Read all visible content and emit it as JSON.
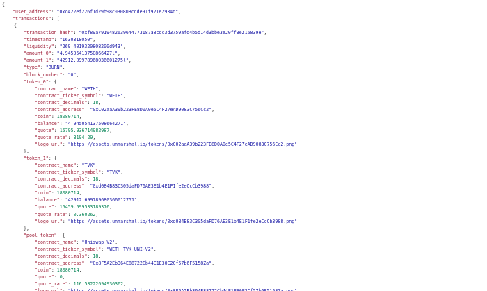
{
  "json_doc": {
    "lines": [
      {
        "indent": 0,
        "parts": [
          {
            "t": "p",
            "v": "{"
          }
        ]
      },
      {
        "indent": 1,
        "parts": [
          {
            "t": "k",
            "v": "\"user_address\""
          },
          {
            "t": "p",
            "v": ": "
          },
          {
            "t": "s",
            "v": "\"0xc422ef226f1d29b98c030808cdde91f921e2934d\""
          },
          {
            "t": "p",
            "v": ","
          }
        ]
      },
      {
        "indent": 1,
        "parts": [
          {
            "t": "k",
            "v": "\"transactions\""
          },
          {
            "t": "p",
            "v": ": ["
          }
        ]
      },
      {
        "indent": 2,
        "parts": [
          {
            "t": "p",
            "v": "{"
          }
        ]
      },
      {
        "indent": 3,
        "parts": [
          {
            "t": "k",
            "v": "\"transaction_hash\""
          },
          {
            "t": "p",
            "v": ": "
          },
          {
            "t": "s",
            "v": "\"0xf89a7919482639644773187a8cdc3d3759afd4b5d14d3bbe3e20ff3e216839e\""
          },
          {
            "t": "p",
            "v": ","
          }
        ]
      },
      {
        "indent": 3,
        "parts": [
          {
            "t": "k",
            "v": "\"timestamp\""
          },
          {
            "t": "p",
            "v": ": "
          },
          {
            "t": "s",
            "v": "\"1630318050\""
          },
          {
            "t": "p",
            "v": ","
          }
        ]
      },
      {
        "indent": 3,
        "parts": [
          {
            "t": "k",
            "v": "\"liquidity\""
          },
          {
            "t": "p",
            "v": ": "
          },
          {
            "t": "s",
            "v": "\"269.4019320808200d943\""
          },
          {
            "t": "p",
            "v": ","
          }
        ]
      },
      {
        "indent": 3,
        "parts": [
          {
            "t": "k",
            "v": "\"amount_0\""
          },
          {
            "t": "p",
            "v": ": "
          },
          {
            "t": "s",
            "v": "\"4.94505413750866427l\""
          },
          {
            "t": "p",
            "v": ","
          }
        ]
      },
      {
        "indent": 3,
        "parts": [
          {
            "t": "k",
            "v": "\"amount_1\""
          },
          {
            "t": "p",
            "v": ": "
          },
          {
            "t": "s",
            "v": "\"42912.09978968036601275l\""
          },
          {
            "t": "p",
            "v": ","
          }
        ]
      },
      {
        "indent": 3,
        "parts": [
          {
            "t": "k",
            "v": "\"type\""
          },
          {
            "t": "p",
            "v": ": "
          },
          {
            "t": "s",
            "v": "\"BURN\""
          },
          {
            "t": "p",
            "v": ","
          }
        ]
      },
      {
        "indent": 3,
        "parts": [
          {
            "t": "k",
            "v": "\"block_number\""
          },
          {
            "t": "p",
            "v": ": "
          },
          {
            "t": "s",
            "v": "\"0\""
          },
          {
            "t": "p",
            "v": ","
          }
        ]
      },
      {
        "indent": 3,
        "parts": [
          {
            "t": "k",
            "v": "\"token_0\""
          },
          {
            "t": "p",
            "v": ": {"
          }
        ]
      },
      {
        "indent": 4,
        "parts": [
          {
            "t": "k",
            "v": "\"contract_name\""
          },
          {
            "t": "p",
            "v": ": "
          },
          {
            "t": "s",
            "v": "\"WETH\""
          },
          {
            "t": "p",
            "v": ","
          }
        ]
      },
      {
        "indent": 4,
        "parts": [
          {
            "t": "k",
            "v": "\"contract_ticker_symbol\""
          },
          {
            "t": "p",
            "v": ": "
          },
          {
            "t": "s",
            "v": "\"WETH\""
          },
          {
            "t": "p",
            "v": ","
          }
        ]
      },
      {
        "indent": 4,
        "parts": [
          {
            "t": "k",
            "v": "\"contract_decimals\""
          },
          {
            "t": "p",
            "v": ": "
          },
          {
            "t": "n",
            "v": "18"
          },
          {
            "t": "p",
            "v": ","
          }
        ]
      },
      {
        "indent": 4,
        "parts": [
          {
            "t": "k",
            "v": "\"contract_address\""
          },
          {
            "t": "p",
            "v": ": "
          },
          {
            "t": "s",
            "v": "\"0xC02aaA39b223FE8D0A0e5C4F27eAD9083C756Cc2\""
          },
          {
            "t": "p",
            "v": ","
          }
        ]
      },
      {
        "indent": 4,
        "parts": [
          {
            "t": "k",
            "v": "\"coin\""
          },
          {
            "t": "p",
            "v": ": "
          },
          {
            "t": "n",
            "v": "18080714"
          },
          {
            "t": "p",
            "v": ","
          }
        ]
      },
      {
        "indent": 4,
        "parts": [
          {
            "t": "k",
            "v": "\"balance\""
          },
          {
            "t": "p",
            "v": ": "
          },
          {
            "t": "s",
            "v": "\"4.945054137508664271\""
          },
          {
            "t": "p",
            "v": ","
          }
        ]
      },
      {
        "indent": 4,
        "parts": [
          {
            "t": "k",
            "v": "\"quote\""
          },
          {
            "t": "p",
            "v": ": "
          },
          {
            "t": "n",
            "v": "15795.936714982987"
          },
          {
            "t": "p",
            "v": ","
          }
        ]
      },
      {
        "indent": 4,
        "parts": [
          {
            "t": "k",
            "v": "\"quote_rate\""
          },
          {
            "t": "p",
            "v": ": "
          },
          {
            "t": "n",
            "v": "3194.29"
          },
          {
            "t": "p",
            "v": ","
          }
        ]
      },
      {
        "indent": 4,
        "parts": [
          {
            "t": "k",
            "v": "\"logo_url\""
          },
          {
            "t": "p",
            "v": ": "
          },
          {
            "t": "u",
            "v": "\"https://assets.unmarshal.io/tokens/0xC02aaA39b223FE8D0A0e5C4F27eAD9083C756Cc2.png\""
          }
        ]
      },
      {
        "indent": 3,
        "parts": [
          {
            "t": "p",
            "v": "},"
          }
        ]
      },
      {
        "indent": 3,
        "parts": [
          {
            "t": "k",
            "v": "\"token_1\""
          },
          {
            "t": "p",
            "v": ": {"
          }
        ]
      },
      {
        "indent": 4,
        "parts": [
          {
            "t": "k",
            "v": "\"contract_name\""
          },
          {
            "t": "p",
            "v": ": "
          },
          {
            "t": "s",
            "v": "\"TVK\""
          },
          {
            "t": "p",
            "v": ","
          }
        ]
      },
      {
        "indent": 4,
        "parts": [
          {
            "t": "k",
            "v": "\"contract_ticker_symbol\""
          },
          {
            "t": "p",
            "v": ": "
          },
          {
            "t": "s",
            "v": "\"TVK\""
          },
          {
            "t": "p",
            "v": ","
          }
        ]
      },
      {
        "indent": 4,
        "parts": [
          {
            "t": "k",
            "v": "\"contract_decimals\""
          },
          {
            "t": "p",
            "v": ": "
          },
          {
            "t": "n",
            "v": "18"
          },
          {
            "t": "p",
            "v": ","
          }
        ]
      },
      {
        "indent": 4,
        "parts": [
          {
            "t": "k",
            "v": "\"contract_address\""
          },
          {
            "t": "p",
            "v": ": "
          },
          {
            "t": "s",
            "v": "\"0xd084B83C305daFD76AE3E1b4E1F1fe2eCcCb3988\""
          },
          {
            "t": "p",
            "v": ","
          }
        ]
      },
      {
        "indent": 4,
        "parts": [
          {
            "t": "k",
            "v": "\"coin\""
          },
          {
            "t": "p",
            "v": ": "
          },
          {
            "t": "n",
            "v": "18080714"
          },
          {
            "t": "p",
            "v": ","
          }
        ]
      },
      {
        "indent": 4,
        "parts": [
          {
            "t": "k",
            "v": "\"balance\""
          },
          {
            "t": "p",
            "v": ": "
          },
          {
            "t": "s",
            "v": "\"42912.699789680366012751\""
          },
          {
            "t": "p",
            "v": ","
          }
        ]
      },
      {
        "indent": 4,
        "parts": [
          {
            "t": "k",
            "v": "\"quote\""
          },
          {
            "t": "p",
            "v": ": "
          },
          {
            "t": "n",
            "v": "15459.599533189376"
          },
          {
            "t": "p",
            "v": ","
          }
        ]
      },
      {
        "indent": 4,
        "parts": [
          {
            "t": "k",
            "v": "\"quote_rate\""
          },
          {
            "t": "p",
            "v": ": "
          },
          {
            "t": "n",
            "v": "0.360262"
          },
          {
            "t": "p",
            "v": ","
          }
        ]
      },
      {
        "indent": 4,
        "parts": [
          {
            "t": "k",
            "v": "\"logo_url\""
          },
          {
            "t": "p",
            "v": ": "
          },
          {
            "t": "u",
            "v": "\"https://assets.unmarshal.io/tokens/0xd084B83C305daFD76AE3E1b4E1F1fe2eCcCb3988.png\""
          }
        ]
      },
      {
        "indent": 3,
        "parts": [
          {
            "t": "p",
            "v": "},"
          }
        ]
      },
      {
        "indent": 3,
        "parts": [
          {
            "t": "k",
            "v": "\"pool_token\""
          },
          {
            "t": "p",
            "v": ": {"
          }
        ]
      },
      {
        "indent": 4,
        "parts": [
          {
            "t": "k",
            "v": "\"contract_name\""
          },
          {
            "t": "p",
            "v": ": "
          },
          {
            "t": "s",
            "v": "\"Uniswap V2\""
          },
          {
            "t": "p",
            "v": ","
          }
        ]
      },
      {
        "indent": 4,
        "parts": [
          {
            "t": "k",
            "v": "\"contract_ticker_symbol\""
          },
          {
            "t": "p",
            "v": ": "
          },
          {
            "t": "s",
            "v": "\"WETH TVK UNI-V2\""
          },
          {
            "t": "p",
            "v": ","
          }
        ]
      },
      {
        "indent": 4,
        "parts": [
          {
            "t": "k",
            "v": "\"contract_decimals\""
          },
          {
            "t": "p",
            "v": ": "
          },
          {
            "t": "n",
            "v": "18"
          },
          {
            "t": "p",
            "v": ","
          }
        ]
      },
      {
        "indent": 4,
        "parts": [
          {
            "t": "k",
            "v": "\"contract_address\""
          },
          {
            "t": "p",
            "v": ": "
          },
          {
            "t": "s",
            "v": "\"0x8F5A2Eb364E88722Cb44E1E30E2Cf57b6F5158Za\""
          },
          {
            "t": "p",
            "v": ","
          }
        ]
      },
      {
        "indent": 4,
        "parts": [
          {
            "t": "k",
            "v": "\"coin\""
          },
          {
            "t": "p",
            "v": ": "
          },
          {
            "t": "n",
            "v": "18080714"
          },
          {
            "t": "p",
            "v": ","
          }
        ]
      },
      {
        "indent": 4,
        "parts": [
          {
            "t": "k",
            "v": "\"quote\""
          },
          {
            "t": "p",
            "v": ": "
          },
          {
            "t": "n",
            "v": "0"
          },
          {
            "t": "p",
            "v": ","
          }
        ]
      },
      {
        "indent": 4,
        "parts": [
          {
            "t": "k",
            "v": "\"quote_rate\""
          },
          {
            "t": "p",
            "v": ": "
          },
          {
            "t": "n",
            "v": "116.58222694936362"
          },
          {
            "t": "p",
            "v": ","
          }
        ]
      },
      {
        "indent": 4,
        "parts": [
          {
            "t": "k",
            "v": "\"logo_url\""
          },
          {
            "t": "p",
            "v": ": "
          },
          {
            "t": "u",
            "v": "\"https://assets.unmarshal.io/tokens/0x8F5A2Eb364E88722Cb44E1E30E2Cf57b6F5158Za.png\""
          }
        ]
      }
    ]
  },
  "colors": {
    "key": "#a0213a",
    "string": "#1a1aa6",
    "number": "#098658",
    "punctuation": "#333333",
    "background": "#ffffff"
  }
}
